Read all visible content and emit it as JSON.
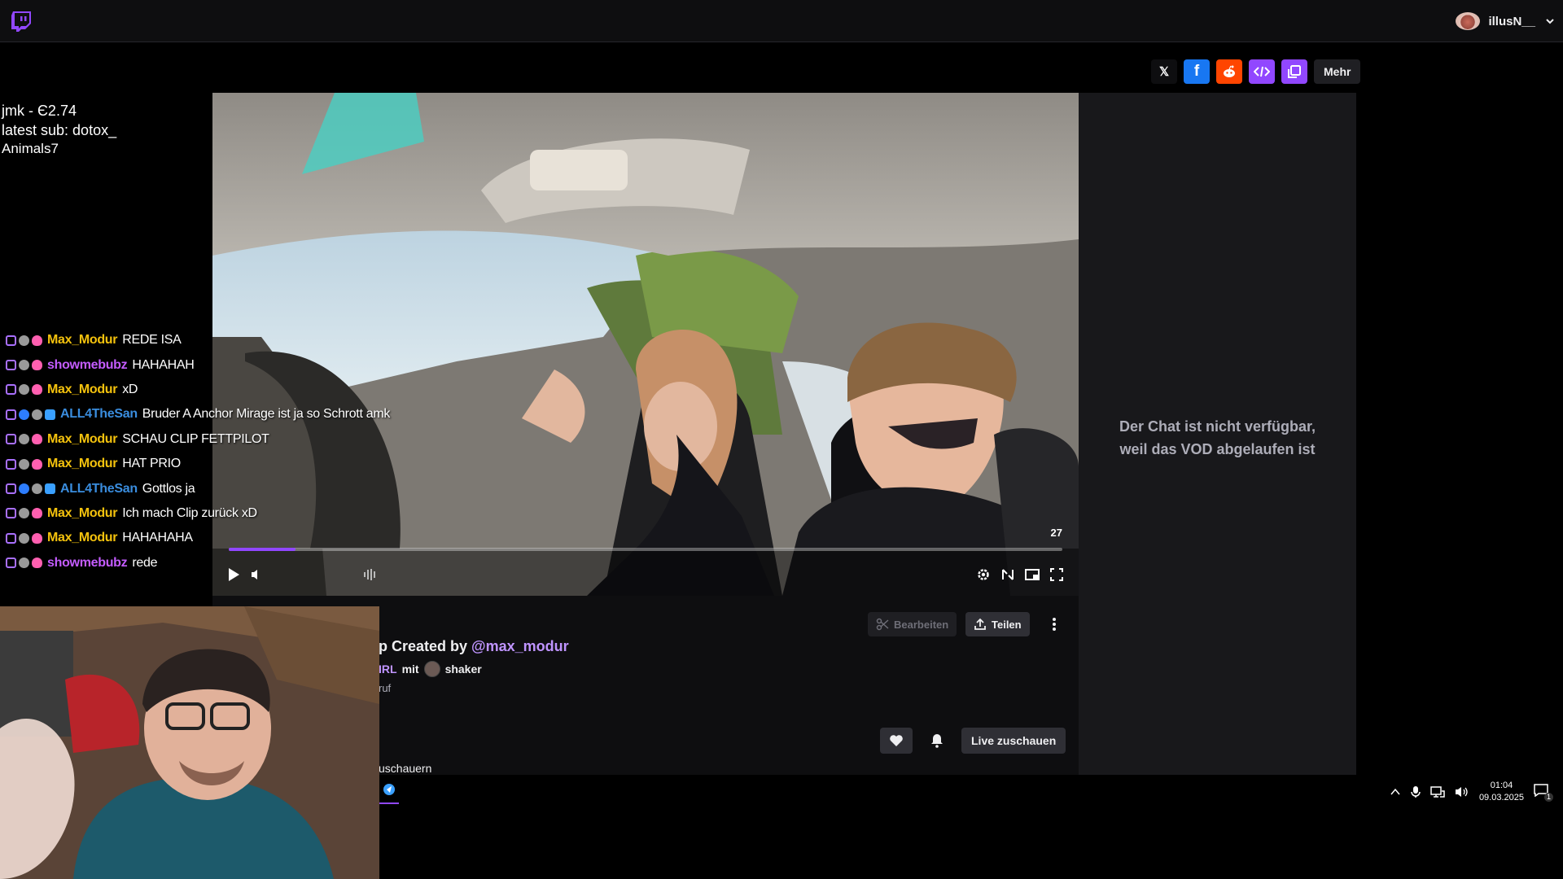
{
  "topbar": {
    "username": "illusN__"
  },
  "share": {
    "x_label": "𝕏",
    "fb_label": "f",
    "more_label": "Mehr"
  },
  "overlay": {
    "line1": "jmk - Є2.74",
    "line2": "latest sub: dotox_",
    "line3": "Animals7"
  },
  "video": {
    "counter": "27",
    "progress_fraction": 0.08
  },
  "right_panel": {
    "line1": "Der Chat ist nicht verfügbar,",
    "line2": "weil das VOD abgelaufen ist"
  },
  "clip": {
    "edit_label": "Bearbeiten",
    "share_label": "Teilen",
    "title_prefix": "p Created by",
    "title_link": "@max_modur",
    "meta_prefix": "IRL",
    "meta_mit": "mit",
    "meta_name": "shaker",
    "sub": "ruf",
    "live_label": "Live zuschauen",
    "viewers_text": "uschauern"
  },
  "chat": [
    {
      "user": "Max_Modur",
      "color": "#f4c20d",
      "msg": "REDE ISA",
      "badges": [
        "sub",
        "gray",
        "heart"
      ]
    },
    {
      "user": "showmebubz",
      "color": "#c45cff",
      "msg": "HAHAHAH",
      "badges": [
        "sub",
        "gray",
        "heart"
      ]
    },
    {
      "user": "Max_Modur",
      "color": "#f4c20d",
      "msg": "xD",
      "badges": [
        "sub",
        "gray",
        "heart"
      ]
    },
    {
      "user": "ALL4TheSan",
      "color": "#3a8dde",
      "msg": "Bruder A Anchor Mirage ist ja so Schrott amk",
      "badges": [
        "sub",
        "blue",
        "gray",
        "tv"
      ]
    },
    {
      "user": "Max_Modur",
      "color": "#f4c20d",
      "msg": "SCHAU CLIP FETTPILOT",
      "badges": [
        "sub",
        "gray",
        "heart"
      ]
    },
    {
      "user": "Max_Modur",
      "color": "#f4c20d",
      "msg": "HAT PRIO",
      "badges": [
        "sub",
        "gray",
        "heart"
      ]
    },
    {
      "user": "ALL4TheSan",
      "color": "#3a8dde",
      "msg": "Gottlos ja",
      "badges": [
        "sub",
        "blue",
        "gray",
        "tv"
      ]
    },
    {
      "user": "Max_Modur",
      "color": "#f4c20d",
      "msg": "Ich mach Clip zurück xD",
      "badges": [
        "sub",
        "gray",
        "heart"
      ]
    },
    {
      "user": "Max_Modur",
      "color": "#f4c20d",
      "msg": "HAHAHAHA",
      "badges": [
        "sub",
        "gray",
        "heart"
      ]
    },
    {
      "user": "showmebubz",
      "color": "#c45cff",
      "msg": "rede",
      "badges": [
        "sub",
        "gray",
        "heart"
      ]
    }
  ],
  "taskbar": {
    "time": "01:04",
    "date": "09.03.2025",
    "notif_count": "1"
  }
}
